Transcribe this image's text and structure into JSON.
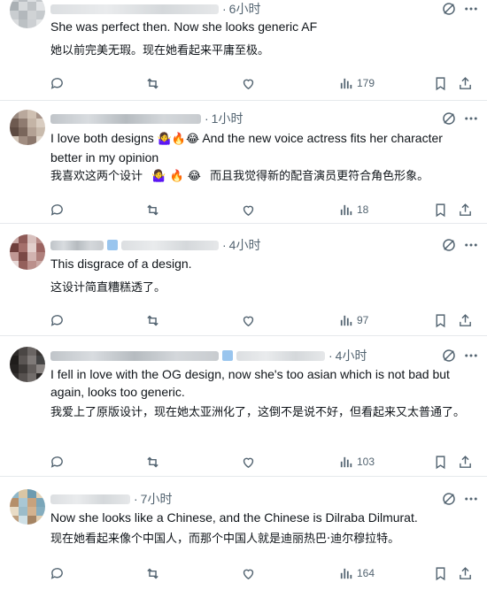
{
  "tweets": [
    {
      "time": "6小时",
      "text": "She was perfect then. Now she looks generic AF",
      "translation": "她以前完美无瑕。现在她看起来平庸至极。",
      "views": "179",
      "avatar_colors": [
        "#cfd3d6",
        "#b8bdc1",
        "#dde0e2",
        "#c4c8cb",
        "#aab0b4",
        "#d6d9db",
        "#bfc3c6",
        "#e1e3e5",
        "#c9cdd0",
        "#b3b8bc",
        "#d0d3d5",
        "#c6cacd",
        "#dadcde",
        "#bcc1c4",
        "#cdd0d3",
        "#e4e6e7"
      ]
    },
    {
      "time": "1小时",
      "text_before_emoji": "I love both designs",
      "emoji": "🤷‍♀️🔥😂",
      "text_after_emoji": "And the new voice actress fits her character better in my opinion",
      "translation_before": "我喜欢这两个设计",
      "translation_emoji": "🤷‍♀️ 🔥 😂",
      "translation_after": "而且我觉得新的配音演员更符合角色形象。",
      "views": "18",
      "avatar_colors": [
        "#9a8a80",
        "#b9a89c",
        "#cfc0b2",
        "#a79489",
        "#6e5a50",
        "#8f7b70",
        "#c4b4a6",
        "#d9cdc1",
        "#5d4a41",
        "#7a665b",
        "#b3a194",
        "#c9bbad",
        "#d4c7ba",
        "#a18d81",
        "#8c786d",
        "#e0d6cb"
      ]
    },
    {
      "time": "4小时",
      "text": "This disgrace of a design.",
      "translation": "这设计简直糟糕透了。",
      "views": "97",
      "avatar_colors": [
        "#c9a9a6",
        "#8e5a57",
        "#d8c0bd",
        "#b88a86",
        "#6f3f3c",
        "#a46f6b",
        "#e2cfcc",
        "#9b6461",
        "#c09894",
        "#7a4845",
        "#d1b3b0",
        "#af807c",
        "#e8dad8",
        "#94605c",
        "#bb908c",
        "#caa8a4"
      ]
    },
    {
      "time": "4小时",
      "text": "I fell in love with the OG design, now she's too asian which is not bad but again, looks too generic.",
      "translation": "我爱上了原版设计，现在她太亚洲化了，这倒不是说不好，但看起来又太普通了。",
      "views": "103",
      "avatar_colors": [
        "#2e2b2a",
        "#4a4644",
        "#6a6563",
        "#3a3634",
        "#1f1c1b",
        "#5a5553",
        "#7f7a78",
        "#444",
        "#252221",
        "#3f3b39",
        "#625d5b",
        "#8a8583",
        "#33302f",
        "#56514f",
        "#726d6b",
        "#2a2726"
      ]
    },
    {
      "time": "7小时",
      "text": "Now she looks like a Chinese, and the Chinese is Dilraba Dilmurat.",
      "translation": "现在她看起来像个中国人，而那个中国人就是迪丽热巴·迪尔穆拉特。",
      "views": "164",
      "avatar_colors": [
        "#8fb7c9",
        "#d9c6a5",
        "#6d9bb0",
        "#e4d3b8",
        "#b58f6a",
        "#a9c7d4",
        "#c7a27d",
        "#7aa6b9",
        "#e9dcc6",
        "#9cbcc9",
        "#d3b28f",
        "#86aebf",
        "#bfa07f",
        "#cfe0e6",
        "#a58463",
        "#e0cdb0"
      ]
    }
  ]
}
